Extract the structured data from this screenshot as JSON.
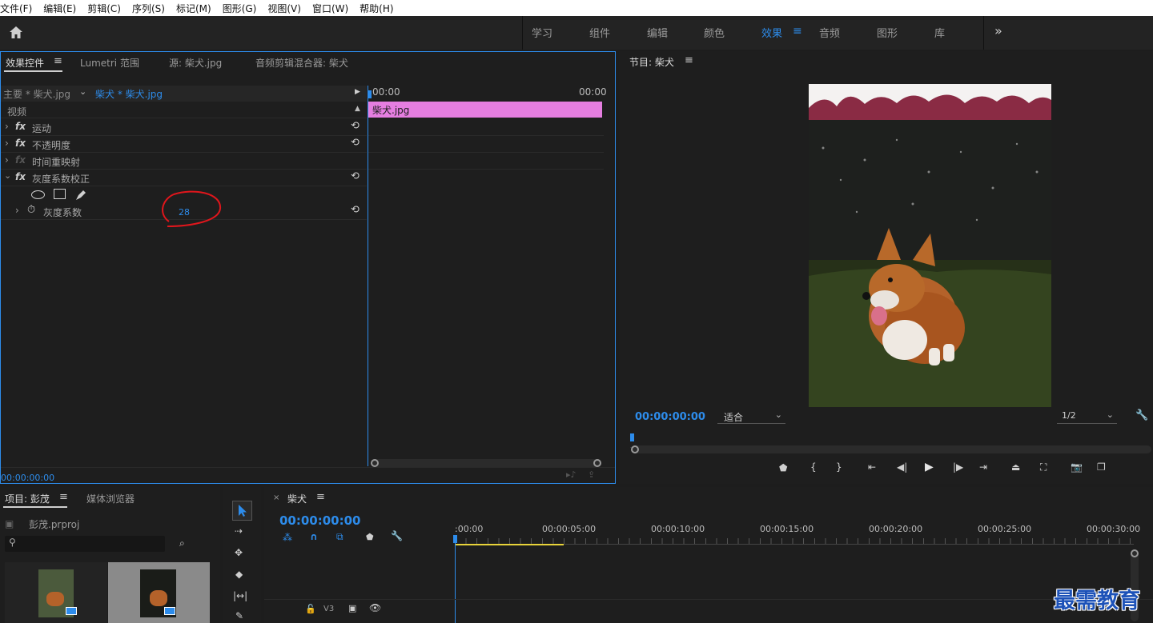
{
  "menu": [
    "文件(F)",
    "编辑(E)",
    "剪辑(C)",
    "序列(S)",
    "标记(M)",
    "图形(G)",
    "视图(V)",
    "窗口(W)",
    "帮助(H)"
  ],
  "workspaces": {
    "items": [
      "学习",
      "组件",
      "编辑",
      "颜色",
      "效果",
      "音频",
      "图形",
      "库"
    ],
    "active": "效果"
  },
  "effect_controls": {
    "tabs": [
      "效果控件",
      "Lumetri 范围",
      "源: 柴犬.jpg",
      "音频剪辑混合器: 柴犬"
    ],
    "master_clip": "主要 * 柴犬.jpg",
    "seq_clip": "柴犬 * 柴犬.jpg",
    "time_start": "00:00",
    "time_end": "00:00",
    "clip_label": "柴犬.jpg",
    "video_header": "视频",
    "effects": [
      "运动",
      "不透明度",
      "时间重映射",
      "灰度系数校正"
    ],
    "param_label": "灰度系数",
    "param_value": "28",
    "timecode": "00:00:00:00"
  },
  "program": {
    "title": "节目: 柴犬",
    "timecode": "00:00:00:00",
    "fit": "适合",
    "resolution": "1/2"
  },
  "project": {
    "tabs": [
      "项目: 彭茂",
      "媒体浏览器"
    ],
    "file": "彭茂.prproj",
    "search_placeholder": ""
  },
  "timeline": {
    "seq_name": "柴犬",
    "timecode": "00:00:00:00",
    "ruler": [
      ":00:00",
      "00:00:05:00",
      "00:00:10:00",
      "00:00:15:00",
      "00:00:20:00",
      "00:00:25:00",
      "00:00:30:00"
    ],
    "track": "V3"
  },
  "watermark": "最需教育",
  "colors": {
    "accent": "#2d8ceb",
    "clip": "#e57ee0",
    "annotation": "#e0161c",
    "work_area": "#e8d33a"
  }
}
